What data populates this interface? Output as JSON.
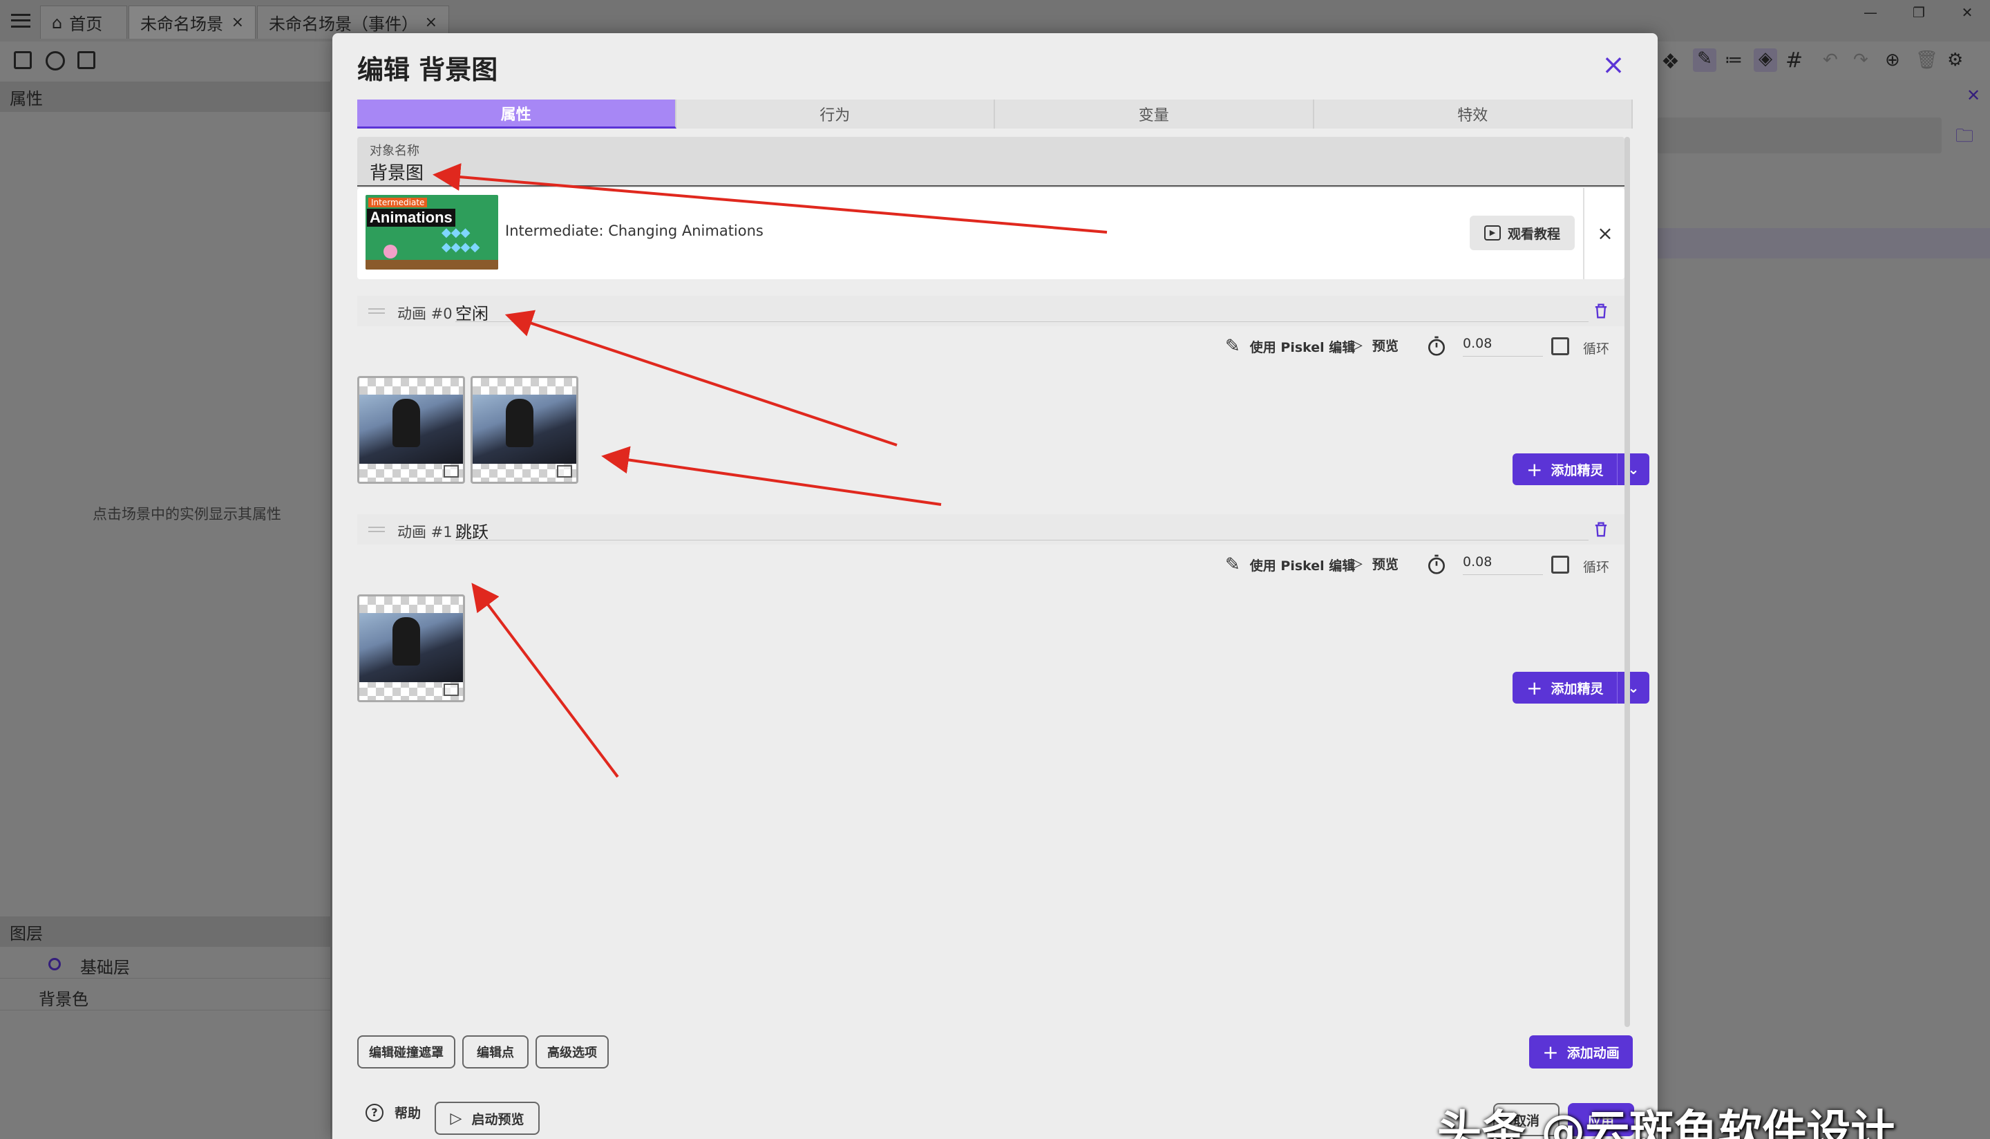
{
  "app": {
    "tabs": [
      {
        "label": "首页"
      },
      {
        "label": "未命名场景"
      },
      {
        "label": "未命名场景（事件）"
      }
    ],
    "left_panel": {
      "properties_header": "属性",
      "hint": "点击场景中的实例显示其属性",
      "layers_header": "图层",
      "layers": [
        {
          "label": "基础层"
        },
        {
          "label": "背景色"
        }
      ]
    }
  },
  "dialog": {
    "title": "编辑 背景图",
    "tabs": [
      {
        "label": "属性",
        "active": true
      },
      {
        "label": "行为",
        "active": false
      },
      {
        "label": "变量",
        "active": false
      },
      {
        "label": "特效",
        "active": false
      }
    ],
    "object_name": {
      "label": "对象名称",
      "value": "背景图"
    },
    "tutorial": {
      "thumb_tag": "Intermediate",
      "thumb_title": "Animations",
      "title": "Intermediate: Changing Animations",
      "watch_label": "观看教程"
    },
    "animations": [
      {
        "index": "动画 #0",
        "name": "空闲",
        "piskel_label": "使用 Piskel 编辑",
        "preview_label": "预览",
        "speed": "0.08",
        "loop_label": "循环",
        "frame_count": 2,
        "add_sprite_label": "添加精灵"
      },
      {
        "index": "动画 #1",
        "name": "跳跃",
        "piskel_label": "使用 Piskel 编辑",
        "preview_label": "预览",
        "speed": "0.08",
        "loop_label": "循环",
        "frame_count": 1,
        "add_sprite_label": "添加精灵"
      }
    ],
    "bottom_buttons": {
      "collision": "编辑碰撞遮罩",
      "points": "编辑点",
      "advanced": "高级选项",
      "add_animation": "添加动画"
    },
    "footer": {
      "help": "帮助",
      "launch_preview": "启动预览",
      "cancel": "取消",
      "apply": "应用"
    }
  },
  "watermark": "头条 @云斑鱼软件设计",
  "colors": {
    "accent": "#5b34d6",
    "active_tab": "#a787f5",
    "annotation_arrow": "#e0281e"
  }
}
